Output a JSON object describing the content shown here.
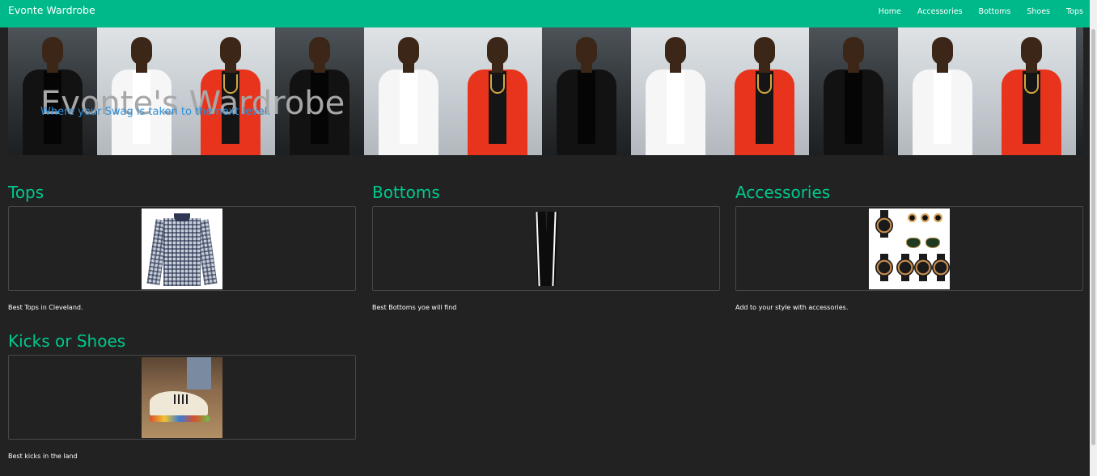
{
  "navbar": {
    "brand": "Evonte Wardrobe",
    "links": [
      "Home",
      "Accessories",
      "Bottoms",
      "Shoes",
      "Tops"
    ]
  },
  "hero": {
    "title": "Evonte's Wardrobe",
    "subtitle": "Where your Swag is taken to the next level."
  },
  "sections": [
    {
      "heading": "Tops",
      "caption": "Best Tops in Cleveland.",
      "image": "shirt-image"
    },
    {
      "heading": "Bottoms",
      "caption": "Best Bottoms yoe will find",
      "image": "pants-image"
    },
    {
      "heading": "Accessories",
      "caption": "Add to your style with accessories.",
      "image": "accessories-image"
    },
    {
      "heading": "Kicks or Shoes",
      "caption": "Best kicks in the land",
      "image": "shoe-image"
    }
  ],
  "colors": {
    "navbar": "#00b98a",
    "accent": "#00c98d",
    "background": "#222222",
    "subtitle": "#2f8fd9"
  }
}
